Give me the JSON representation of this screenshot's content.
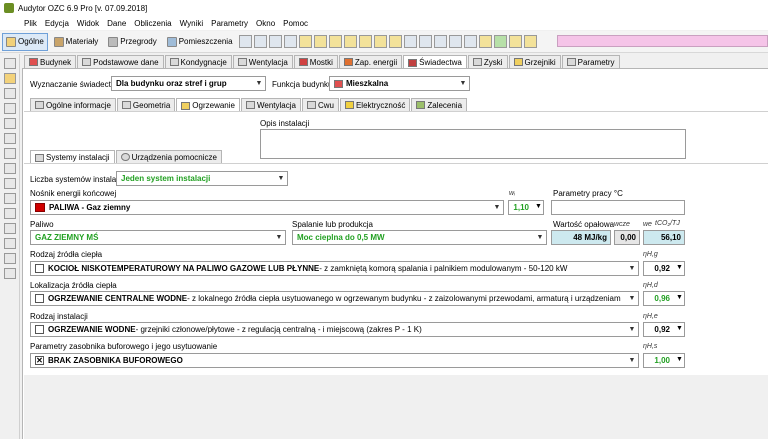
{
  "window": {
    "title": "Audytor OZC 6.9 Pro [v. 07.09.2018]"
  },
  "menu": [
    "Plik",
    "Edycja",
    "Widok",
    "Dane",
    "Obliczenia",
    "Wyniki",
    "Parametry",
    "Okno",
    "Pomoc"
  ],
  "toolbar": {
    "ogolne": "Ogólne",
    "materialy": "Materiały",
    "przegrody": "Przegrody",
    "pomieszczenia": "Pomieszczenia"
  },
  "main_tabs": [
    "Budynek",
    "Podstawowe dane",
    "Kondygnacje",
    "Wentylacja",
    "Mostki",
    "Zap. energii",
    "Świadectwa",
    "Zyski",
    "Grzejniki",
    "Parametry"
  ],
  "header": {
    "wyznaczanie_label": "Wyznaczanie świadectw",
    "wyznaczanie_value": "Dla budynku oraz stref i grup",
    "funkcja_label": "Funkcja budynku",
    "funkcja_value": "Mieszkalna"
  },
  "sub_tabs": [
    "Ogólne informacje",
    "Geometria",
    "Ogrzewanie",
    "Wentylacja",
    "Cwu",
    "Elektryczność",
    "Zalecenia"
  ],
  "opis_label": "Opis instalacji",
  "inner_tabs": [
    "Systemy instalacji",
    "Urządzenia pomocnicze"
  ],
  "liczba": {
    "label": "Liczba systemów instalacji",
    "value": "Jeden system instalacji"
  },
  "nosnik": {
    "label": "Nośnik energii końcowej",
    "value": "PALIWA - Gaz ziemny",
    "wi_label": "wᵢ",
    "wi_value": "1,10",
    "parametry_label": "Parametry pracy  °C"
  },
  "paliwo": {
    "label": "Paliwo",
    "value": "GAZ ZIEMNY MŚ",
    "spalanie_label": "Spalanie lub produkcja",
    "spalanie_value": "Moc cieplna do 0,5 MW",
    "wartosc_label": "Wartość opałowa",
    "wartosc_value": "48 MJ/kg",
    "wcze_label": "wcze",
    "wcze_value": "0,00",
    "we_label": "we",
    "tco2_label": "tCO₂/TJ",
    "tco2_value": "56,10"
  },
  "zrodlo": {
    "label": "Rodzaj źródła ciepła",
    "value_bold": "KOCIOŁ NISKOTEMPERATUROWY NA PALIWO GAZOWE LUB PŁYNNE",
    "value_rest": " - z zamkniętą komorą spalania i palnikiem modulowanym - 50-120 kW",
    "eta_label": "ηH,g",
    "eta_value": "0,92"
  },
  "lokalizacja": {
    "label": "Lokalizacja źródła ciepła",
    "value_bold": "OGRZEWANIE CENTRALNE WODNE",
    "value_rest": " - z lokalnego źródła ciepła usytuowanego w ogrzewanym budynku - z zaizolowanymi przewodami, armaturą i urządzeniam",
    "eta_label": "ηH,d",
    "eta_value": "0,96"
  },
  "instalacja": {
    "label": "Rodzaj instalacji",
    "value_bold": "OGRZEWANIE WODNE",
    "value_rest": " - grzejniki członowe/płytowe - z regulacją centralną - i miejscową (zakres P - 1 K)",
    "eta_label": "ηH,e",
    "eta_value": "0,92"
  },
  "zasobnik": {
    "label": "Parametry zasobnika buforowego i jego usytuowanie",
    "value": "BRAK ZASOBNIKA BUFOROWEGO",
    "eta_label": "ηH,s",
    "eta_value": "1,00"
  }
}
